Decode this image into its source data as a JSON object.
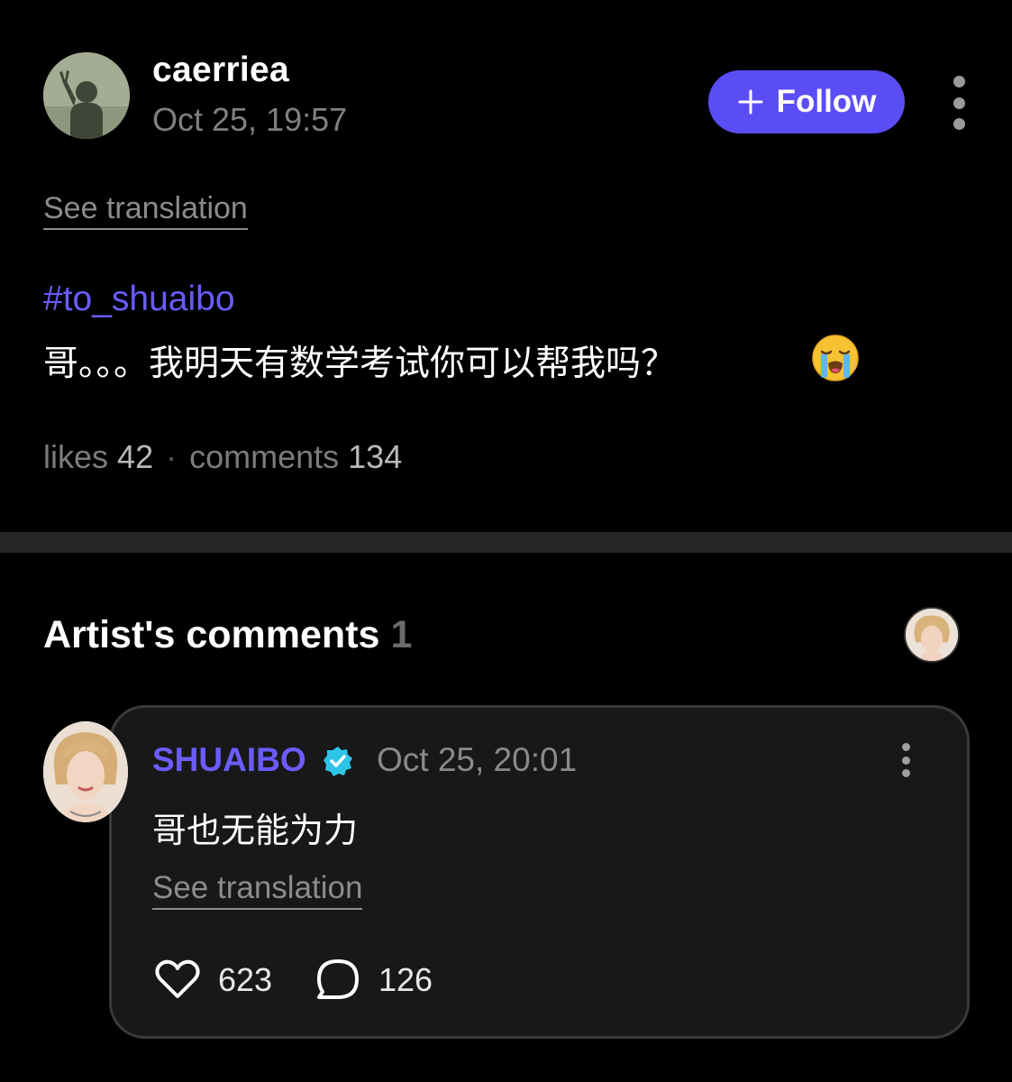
{
  "post": {
    "username": "caerriea",
    "timestamp": "Oct 25, 19:57",
    "follow_label": "Follow",
    "see_translation": "See translation",
    "hashtag": "#to_shuaibo",
    "text": "哥。。。我明天有数学考试你可以帮我吗？",
    "emoji": "loudly-crying-face",
    "likes_label": "likes",
    "likes_count": "42",
    "separator": "·",
    "comments_label": "comments",
    "comments_count": "134"
  },
  "artist_comments": {
    "title": "Artist's comments",
    "count": "1"
  },
  "comment": {
    "author": "SHUAIBO",
    "verified": true,
    "timestamp": "Oct 25, 20:01",
    "text": "哥也无能为力",
    "see_translation": "See translation",
    "likes": "623",
    "replies": "126"
  },
  "colors": {
    "accent": "#5b4df5",
    "link": "#6a5cff",
    "verified": "#2ec4e8",
    "background": "#000000",
    "card": "#181818"
  }
}
